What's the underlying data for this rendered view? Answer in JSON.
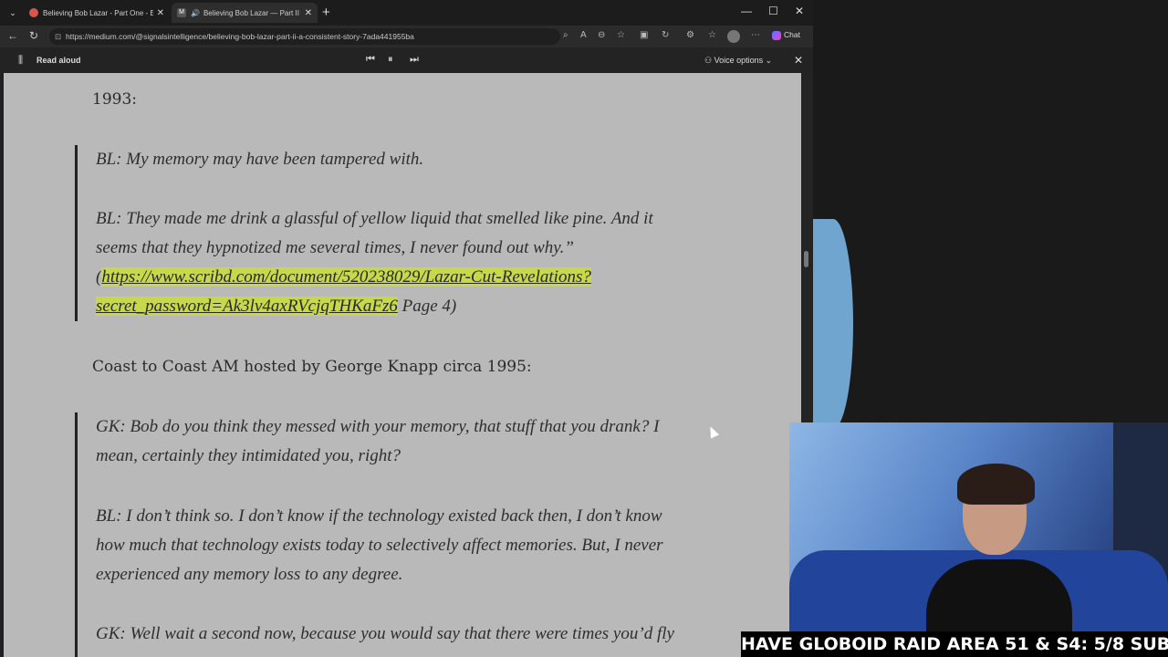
{
  "tabs": [
    {
      "title": "Believing Bob Lazar - Part One - E",
      "favicon_color": "#d9534f"
    },
    {
      "title": "Believing Bob Lazar — Part II",
      "favicon_color": "#555555",
      "favicon_text": "M"
    }
  ],
  "address": {
    "url": "https://medium.com/@signalsintelligence/believing-bob-lazar-part-ii-a-consistent-story-7ada441955ba"
  },
  "toolbar": {
    "chat_label": "Chat"
  },
  "readaloud": {
    "label": "Read aloud",
    "voice_options": "Voice options"
  },
  "article": {
    "year_heading": "1993:",
    "quote1": {
      "line1": "BL: My memory may have been tampered with.",
      "line2a": "BL: They made me drink a glassful of yellow liquid that smelled like pine. And it",
      "line2b": "seems that they hypnotized me several times, I never found out why.”",
      "link_open": "(",
      "link_part1": "https://www.scribd.com/document/520238029/Lazar-Cut-Revelations?",
      "link_part2": "secret_password=Ak3lv4axRVcjqTHKaFz6",
      "link_suffix": " Page 4)"
    },
    "coast_heading": "Coast to Coast AM hosted by George Knapp circa 1995:",
    "quote2": {
      "gk1a": "GK: Bob do you think they messed with your memory, that stuff that you drank? I",
      "gk1b": "mean, certainly they intimidated you, right?",
      "bl1a": "BL: I don’t think so. I don’t know if the technology existed back then, I don’t know",
      "bl1b": "how much that technology exists today to selectively affect memories. But, I never",
      "bl1c": "experienced any memory loss to any degree.",
      "gk2a": "GK: Well wait a second now, because you would say that there were times you’d fly"
    }
  },
  "overlay": {
    "banner": "HAVE GLOBOID RAID AREA 51 & S4: 5/8 SUBS"
  }
}
